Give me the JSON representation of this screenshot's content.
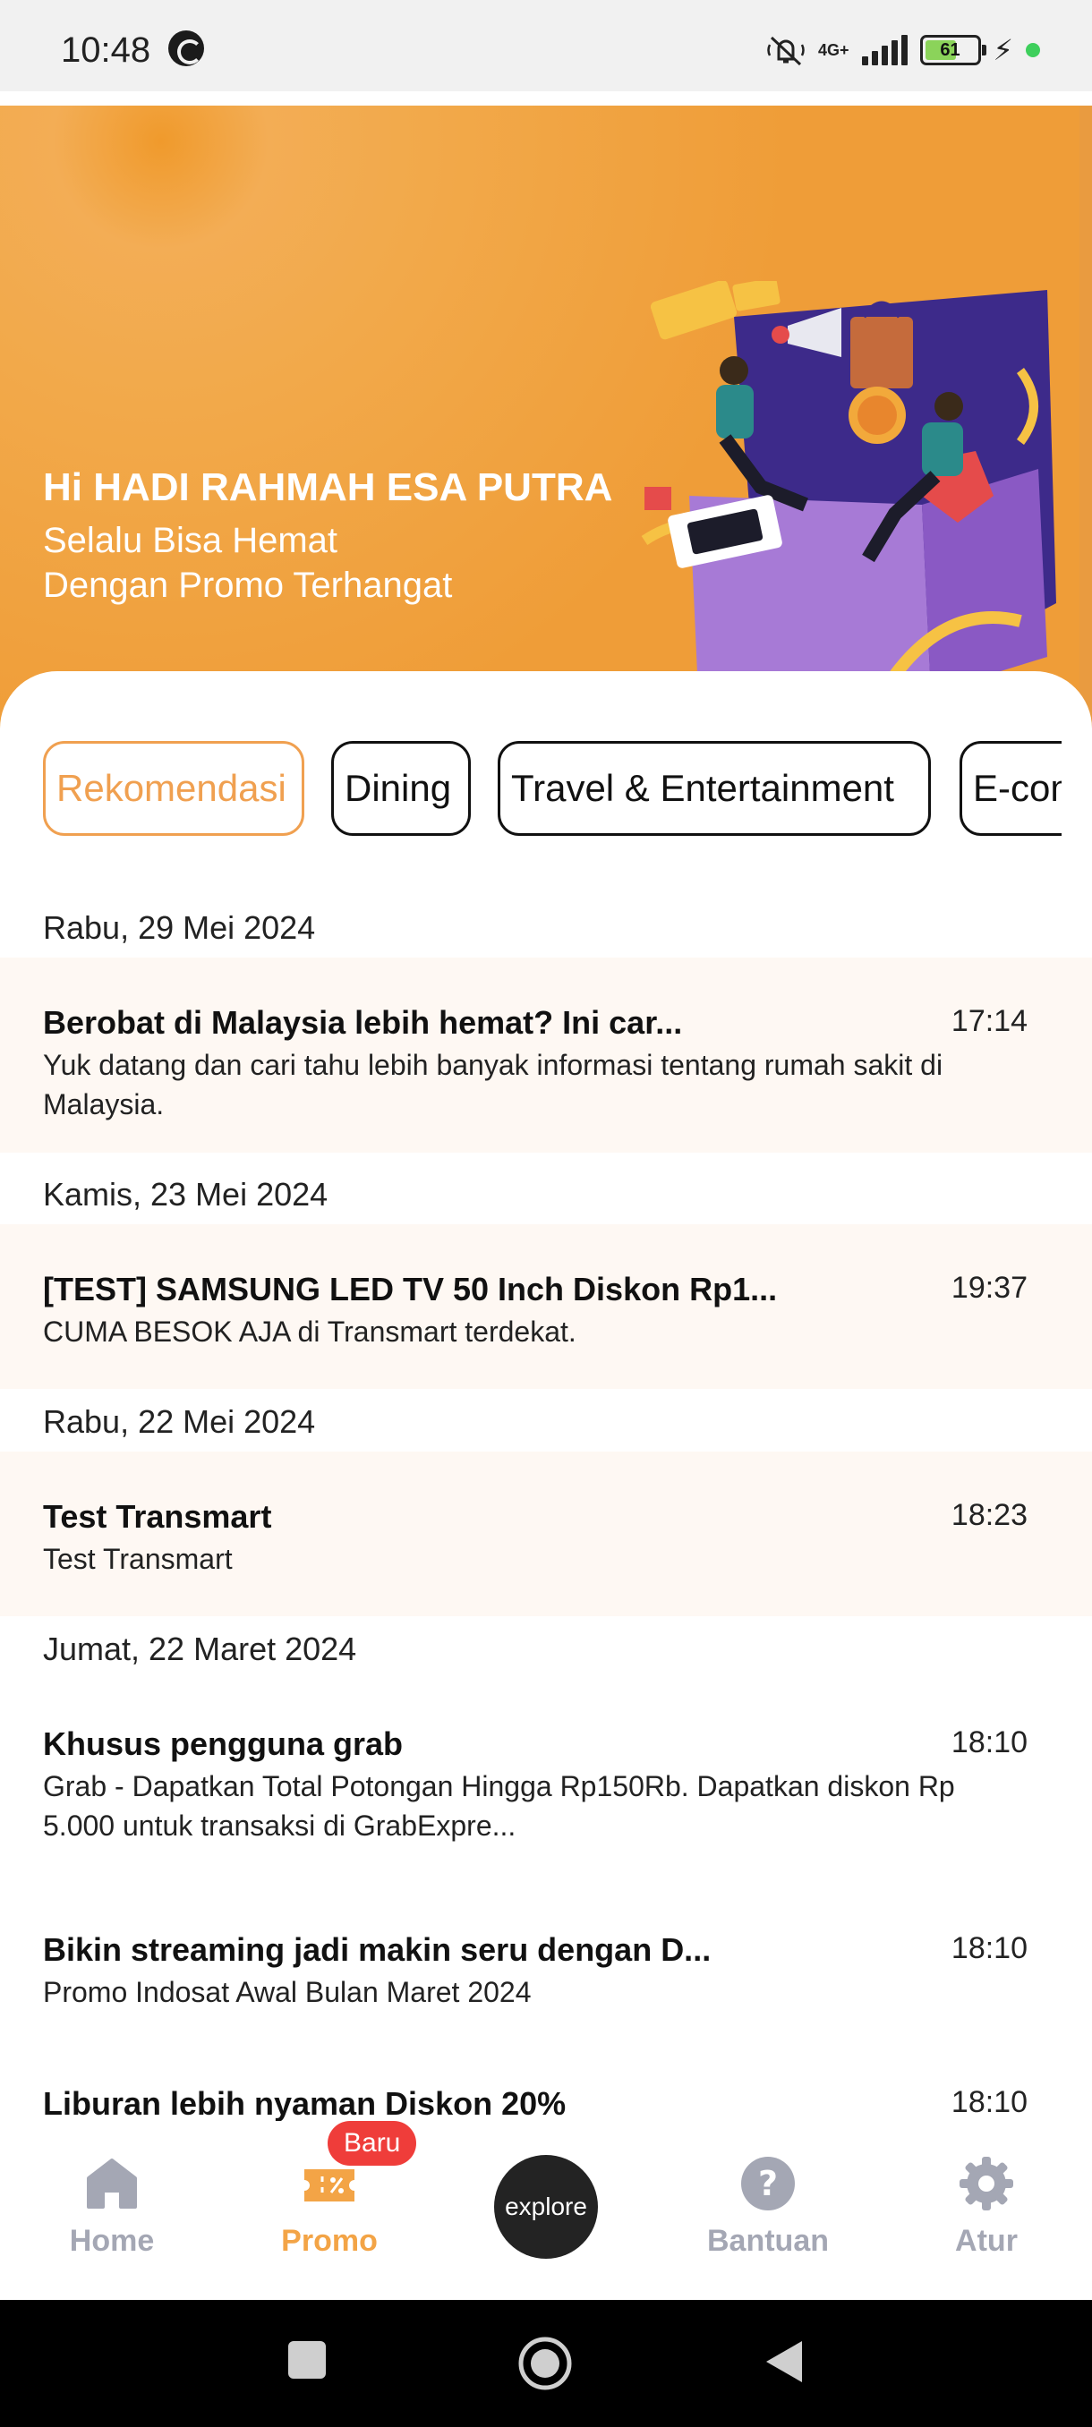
{
  "status_bar": {
    "time": "10:48",
    "network": "4G+",
    "battery": "61",
    "battery_level": 61,
    "icons": [
      "sync-icon",
      "mute-icon",
      "signal-icon",
      "battery-icon",
      "charging-icon",
      "dot-icon"
    ]
  },
  "hero": {
    "greeting": "Hi HADI RAHMAH ESA PUTRA",
    "subtitle_line1": "Selalu Bisa Hemat",
    "subtitle_line2": "Dengan Promo Terhangat"
  },
  "categories": [
    {
      "label": "Rekomendasi",
      "active": true
    },
    {
      "label": "Dining",
      "active": false
    },
    {
      "label": "Travel & Entertainment",
      "active": false
    },
    {
      "label": "E-commerce",
      "active": false
    }
  ],
  "groups": [
    {
      "date": "Rabu, 29 Mei 2024",
      "items": [
        {
          "title": "Berobat di Malaysia lebih hemat? Ini car...",
          "time": "17:14",
          "desc": "Yuk datang dan cari tahu lebih banyak informasi tentang rumah sakit di Malaysia.",
          "highlight": true
        }
      ]
    },
    {
      "date": "Kamis, 23 Mei 2024",
      "items": [
        {
          "title": "[TEST] SAMSUNG LED TV 50 Inch Diskon Rp1...",
          "time": "19:37",
          "desc": "CUMA BESOK AJA di Transmart terdekat.",
          "highlight": true
        }
      ]
    },
    {
      "date": "Rabu, 22 Mei 2024",
      "items": [
        {
          "title": "Test Transmart",
          "time": "18:23",
          "desc": "Test Transmart",
          "highlight": true
        }
      ]
    },
    {
      "date": "Jumat, 22 Maret 2024",
      "items": [
        {
          "title": "Khusus pengguna grab",
          "time": "18:10",
          "desc": "Grab - Dapatkan Total Potongan Hingga Rp150Rb. Dapatkan diskon Rp 5.000 untuk transaksi di GrabExpre...",
          "highlight": false
        },
        {
          "title": "Bikin streaming jadi makin seru dengan D...",
          "time": "18:10",
          "desc": "Promo Indosat Awal Bulan Maret 2024",
          "highlight": false
        },
        {
          "title": "Liburan lebih nyaman Diskon 20%",
          "time": "18:10",
          "desc": "",
          "highlight": false
        }
      ]
    }
  ],
  "bottom_nav": {
    "home": "Home",
    "promo": "Promo",
    "promo_badge": "Baru",
    "explore": "explore",
    "help": "Bantuan",
    "settings": "Atur"
  },
  "colors": {
    "accent": "#F3A446",
    "hero_bg": "#F2A94A",
    "badge": "#EF3D3A",
    "highlight_row": "#FEF8F3"
  }
}
